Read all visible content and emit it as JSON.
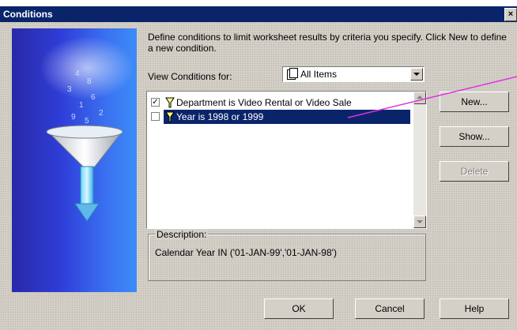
{
  "window": {
    "title": "Conditions",
    "close_glyph": "×"
  },
  "intro_text": "Define conditions to limit worksheet results by criteria you specify. Click New to define a new condition.",
  "view_conditions": {
    "label": "View Conditions for:",
    "selected": "All Items"
  },
  "conditions": [
    {
      "checked": true,
      "text": "Department is Video Rental or Video Sale",
      "selected": false
    },
    {
      "checked": false,
      "text": "Year is 1998 or 1999",
      "selected": true
    }
  ],
  "buttons": {
    "new": "New...",
    "show": "Show...",
    "delete": "Delete",
    "ok": "OK",
    "cancel": "Cancel",
    "help": "Help"
  },
  "description": {
    "label": "Description:",
    "value": "Calendar Year IN ('01-JAN-99','01-JAN-98')"
  },
  "colors": {
    "titlebar": "#0a246a",
    "selection": "#0a246a",
    "dialog": "#d4d0c8",
    "callout_line": "#e030e0",
    "art_blue": "#2f3ed8"
  }
}
